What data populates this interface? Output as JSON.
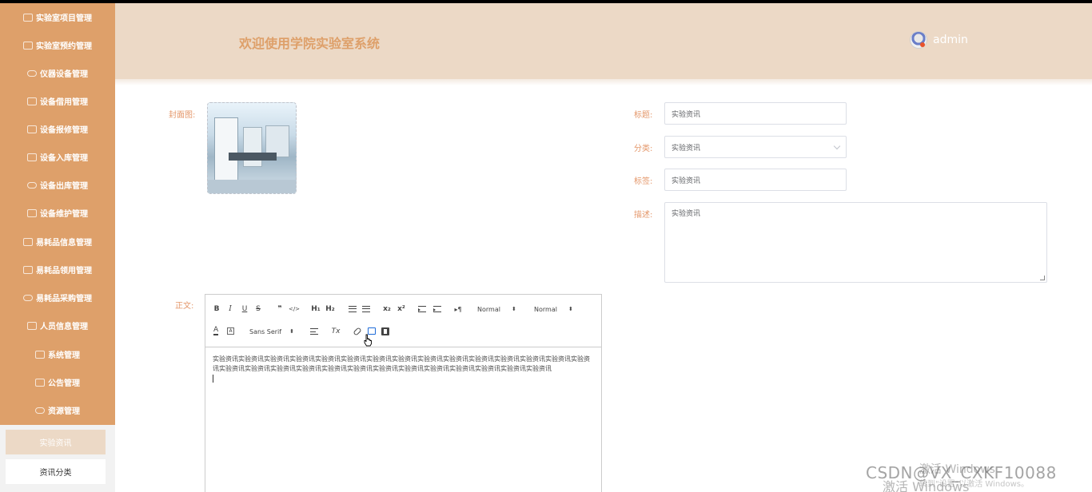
{
  "sidebar": {
    "items": [
      {
        "label": "实验室项目管理",
        "icon": "table-icon"
      },
      {
        "label": "实验室预约管理",
        "icon": "edit-icon"
      },
      {
        "label": "仪器设备管理",
        "icon": "cloud-icon"
      },
      {
        "label": "设备借用管理",
        "icon": "edit-icon"
      },
      {
        "label": "设备报修管理",
        "icon": "document-icon"
      },
      {
        "label": "设备入库管理",
        "icon": "edit-icon"
      },
      {
        "label": "设备出库管理",
        "icon": "cloud-icon"
      },
      {
        "label": "设备维护管理",
        "icon": "edit-icon"
      },
      {
        "label": "易耗品信息管理",
        "icon": "document-icon"
      },
      {
        "label": "易耗品领用管理",
        "icon": "table-icon"
      },
      {
        "label": "易耗品采购管理",
        "icon": "cloud-icon"
      },
      {
        "label": "人员信息管理",
        "icon": "edit-icon"
      },
      {
        "label": "系统管理",
        "icon": "table-icon"
      },
      {
        "label": "公告管理",
        "icon": "edit-icon"
      },
      {
        "label": "资源管理",
        "icon": "cloud-icon"
      }
    ],
    "submenu": {
      "active": "实验资讯",
      "normal": "资讯分类"
    }
  },
  "header": {
    "title": "欢迎使用学院实验室系统",
    "username": "admin"
  },
  "form": {
    "cover_label": "封面图:",
    "title_label": "标题:",
    "title_value": "实验资讯",
    "category_label": "分类:",
    "category_value": "实验资讯",
    "tag_label": "标签:",
    "tag_value": "实验资讯",
    "desc_label": "描述:",
    "desc_value": "实验资讯",
    "body_label": "正文:"
  },
  "editor": {
    "toolbar": {
      "bold": "B",
      "italic": "I",
      "underline": "U",
      "strike": "S",
      "blockquote": "❞",
      "code": "</>",
      "h1": "H₁",
      "h2": "H₂",
      "subscript": "x₂",
      "superscript": "x²",
      "direction": "▸¶",
      "size_select": "Normal",
      "header_select": "Normal",
      "font_select": "Sans Serif",
      "clean": "Tx",
      "color_letter": "A",
      "background_letter": "A"
    },
    "content": "实验资讯实验资讯实验资讯实验资讯实验资讯实验资讯实验资讯实验资讯实验资讯实验资讯实验资讯实验资讯实验资讯实验资讯实验资讯实验资讯实验资讯实验资讯实验资讯实验资讯实验资讯实验资讯实验资讯实验资讯实验资讯实验资讯实验资讯实验资讯"
  },
  "watermark": {
    "csdn": "CSDN@VX_CXKF10088",
    "activate": "激活 Windows",
    "activate_large": "激活 Windows",
    "activate_hint": "转到\"设置\"以激活 Windows。"
  },
  "colors": {
    "sidebar": "#dea06a",
    "header": "#ecd9c6",
    "label": "#e4976a",
    "accent_blue": "#1e6bd8"
  }
}
